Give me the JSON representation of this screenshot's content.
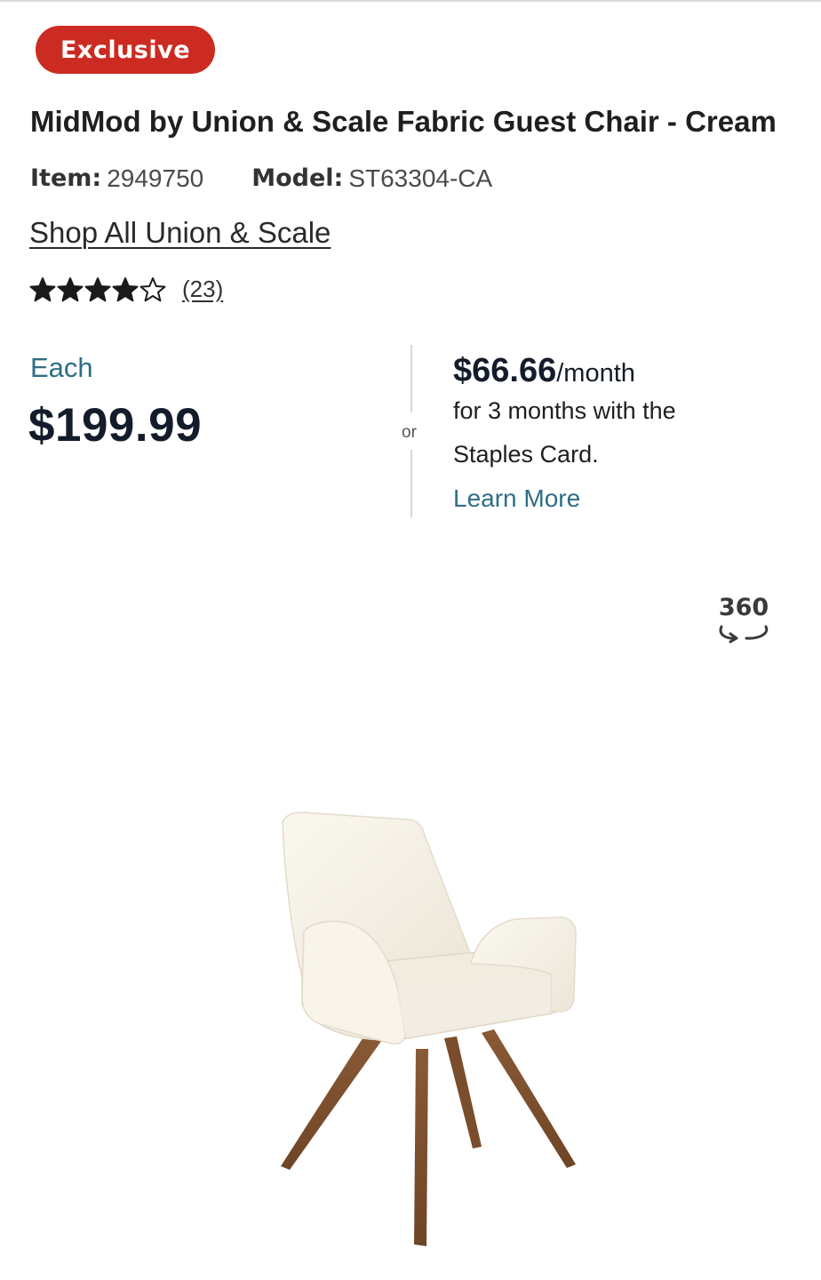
{
  "badge": {
    "label": "Exclusive"
  },
  "product": {
    "title": "MidMod by Union & Scale Fabric Guest Chair - Cream",
    "item_label": "Item:",
    "item_number": "2949750",
    "model_label": "Model:",
    "model_number": "ST63304-CA",
    "brand_link": "Shop All Union & Scale"
  },
  "rating": {
    "stars": 4,
    "max_stars": 5,
    "review_count_text": "(23)"
  },
  "pricing": {
    "each_label": "Each",
    "price": "$199.99",
    "or_text": "or",
    "monthly_amount": "$66.66",
    "monthly_suffix": "/month",
    "financing_line1": "for 3 months with the",
    "financing_line2": "Staples Card.",
    "learn_more": "Learn More"
  },
  "viewer": {
    "label_360": "360",
    "icon": "rotate-360-icon"
  },
  "colors": {
    "badge_red": "#cc2b22",
    "link_teal": "#2d6f86",
    "price_navy": "#141c2b"
  }
}
